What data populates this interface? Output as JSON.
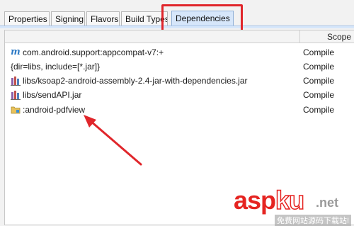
{
  "tabs": [
    {
      "label": "Properties"
    },
    {
      "label": "Signing"
    },
    {
      "label": "Flavors"
    },
    {
      "label": "Build Types"
    },
    {
      "label": "Dependencies"
    }
  ],
  "table": {
    "scope_header": "Scope",
    "rows": [
      {
        "icon": "maven-library-icon",
        "name": "com.android.support:appcompat-v7:+",
        "scope": "Compile"
      },
      {
        "icon": "none",
        "name": "{dir=libs, include=[*.jar]}",
        "scope": "Compile"
      },
      {
        "icon": "jar-library-icon",
        "name": "libs/ksoap2-android-assembly-2.4-jar-with-dependencies.jar",
        "scope": "Compile"
      },
      {
        "icon": "jar-library-icon",
        "name": "libs/sendAPI.jar",
        "scope": "Compile"
      },
      {
        "icon": "module-folder-icon",
        "name": ":android-pdfview",
        "scope": "Compile"
      }
    ]
  },
  "watermark": {
    "part1": "asp",
    "part2": "ku",
    "part3": ".net",
    "subtitle": "免费网站源码下载站!"
  },
  "colors": {
    "annotation": "#e0262b",
    "active_tab": "#d6e6fa",
    "maven_icon": "#2e7bc6"
  }
}
